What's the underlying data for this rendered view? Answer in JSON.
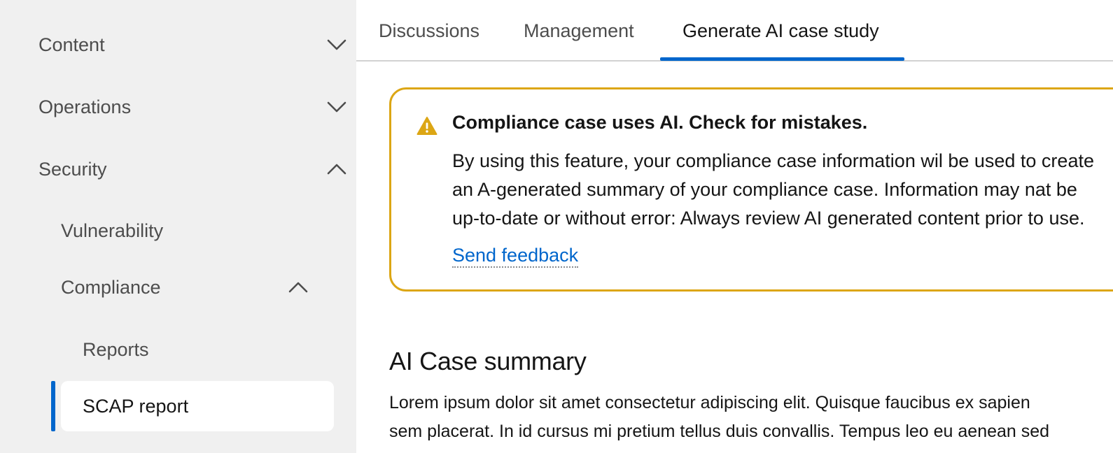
{
  "sidebar": {
    "items": [
      {
        "label": "Content",
        "state": "collapsed",
        "icon": "chevron-down-icon"
      },
      {
        "label": "Operations",
        "state": "collapsed",
        "icon": "chevron-down-icon"
      },
      {
        "label": "Security",
        "state": "expanded",
        "icon": "chevron-up-icon"
      }
    ],
    "security_children": {
      "vulnerability": {
        "label": "Vulnerability"
      },
      "compliance": {
        "label": "Compliance",
        "state": "expanded",
        "icon": "chevron-up-icon"
      }
    },
    "compliance_children": {
      "reports": {
        "label": "Reports"
      },
      "scap_report": {
        "label": "SCAP report",
        "current": true
      }
    }
  },
  "tabs": [
    {
      "label": "Discussions"
    },
    {
      "label": "Management"
    },
    {
      "label": "Generate AI case study",
      "active": true
    }
  ],
  "alert": {
    "icon": "warning-icon",
    "title": "Compliance case uses AI. Check for mistakes.",
    "body_lines": [
      "By using this feature, your compliance case information wil be used to create",
      "an A-generated summary of your compliance case. Information may nat be",
      "up-to-date or without error: Always review AI generated content prior to use."
    ],
    "link_label": "Send feedback"
  },
  "summary": {
    "title": "AI Case summary",
    "body_lines": [
      "Lorem ipsum dolor sit amet consectetur adipiscing elit. Quisque faucibus ex sapien",
      "sem placerat. In id cursus mi pretium tellus duis convallis. Tempus leo eu aenean sed"
    ]
  },
  "colors": {
    "accent": "#0066cc",
    "warning": "#dca614",
    "sidebar_bg": "#f0f0f0"
  }
}
